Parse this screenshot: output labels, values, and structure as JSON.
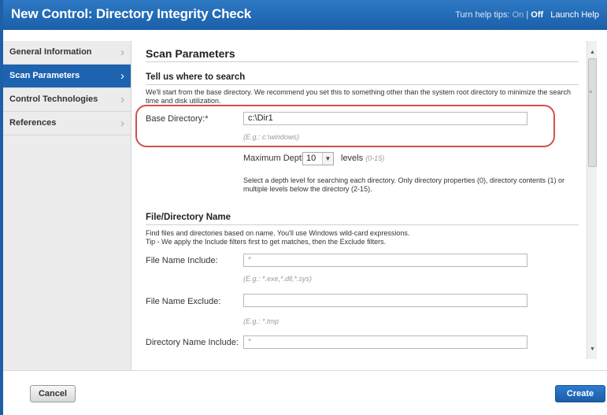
{
  "window": {
    "title": "New Control: Directory Integrity Check",
    "help_tips_label": "Turn help tips:",
    "help_on": "On",
    "help_sep": "|",
    "help_off": "Off",
    "launch_help": "Launch Help"
  },
  "sidebar": {
    "items": [
      {
        "label": "General Information",
        "active": false
      },
      {
        "label": "Scan Parameters",
        "active": true
      },
      {
        "label": "Control Technologies",
        "active": false
      },
      {
        "label": "References",
        "active": false
      }
    ]
  },
  "main": {
    "section_title": "Scan Parameters",
    "where": {
      "title": "Tell us where to search",
      "description": "We'll start from the base directory. We recommend you set this to something other than the system root directory to minimize the search time and disk utilization.",
      "base_dir_label": "Base Directory:*",
      "base_dir_value": "c:\\Dir1",
      "base_dir_hint": "(E.g.: c:\\windows)",
      "depth_label": "Maximum Depth",
      "depth_value": "10",
      "levels_label": "levels",
      "levels_range": "(0-15)",
      "depth_description": "Select a depth level for searching each directory. Only directory properties (0), directory contents (1) or multiple levels below the directory (2-15)."
    },
    "names": {
      "title": "File/Directory Name",
      "description_1": "Find files and directories based on name. You'll use Windows wild-card expressions.",
      "description_2": "Tip - We apply the Include filters first to get matches, then the Exclude filters.",
      "file_include_label": "File Name Include:",
      "file_include_value": "*",
      "file_include_hint": "(E.g.: *.exe,*.dll,*.sys)",
      "file_exclude_label": "File Name Exclude:",
      "file_exclude_value": "",
      "file_exclude_hint": "(E.g.: *.tmp",
      "dir_include_label": "Directory Name Include:",
      "dir_include_value": "*"
    }
  },
  "footer": {
    "cancel_label": "Cancel",
    "create_label": "Create"
  },
  "colors": {
    "titlebar": "#1f66b3",
    "active_nav": "#1d63b0",
    "highlight": "#d35050",
    "primary_button": "#2270c4"
  }
}
